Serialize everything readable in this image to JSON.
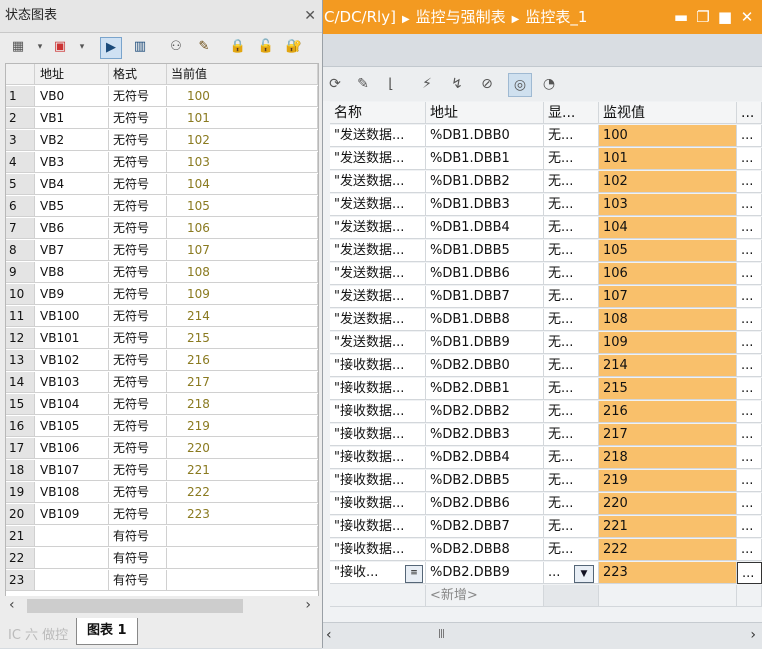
{
  "tia": {
    "title_crumbs": [
      "C/DC/Rly]",
      "监控与强制表",
      "监控表_1"
    ],
    "window_buttons": [
      "▬",
      "❐",
      "■",
      "✕"
    ],
    "columns": [
      "名称",
      "地址",
      "显...",
      "监视值",
      "..."
    ],
    "rows": [
      {
        "name": "\"发送数据...",
        "addr": "%DB1.DBB0",
        "disp": "无...",
        "mon": "100"
      },
      {
        "name": "\"发送数据...",
        "addr": "%DB1.DBB1",
        "disp": "无...",
        "mon": "101"
      },
      {
        "name": "\"发送数据...",
        "addr": "%DB1.DBB2",
        "disp": "无...",
        "mon": "102"
      },
      {
        "name": "\"发送数据...",
        "addr": "%DB1.DBB3",
        "disp": "无...",
        "mon": "103"
      },
      {
        "name": "\"发送数据...",
        "addr": "%DB1.DBB4",
        "disp": "无...",
        "mon": "104"
      },
      {
        "name": "\"发送数据...",
        "addr": "%DB1.DBB5",
        "disp": "无...",
        "mon": "105"
      },
      {
        "name": "\"发送数据...",
        "addr": "%DB1.DBB6",
        "disp": "无...",
        "mon": "106"
      },
      {
        "name": "\"发送数据...",
        "addr": "%DB1.DBB7",
        "disp": "无...",
        "mon": "107"
      },
      {
        "name": "\"发送数据...",
        "addr": "%DB1.DBB8",
        "disp": "无...",
        "mon": "108"
      },
      {
        "name": "\"发送数据...",
        "addr": "%DB1.DBB9",
        "disp": "无...",
        "mon": "109"
      },
      {
        "name": "\"接收数据...",
        "addr": "%DB2.DBB0",
        "disp": "无...",
        "mon": "214"
      },
      {
        "name": "\"接收数据...",
        "addr": "%DB2.DBB1",
        "disp": "无...",
        "mon": "215"
      },
      {
        "name": "\"接收数据...",
        "addr": "%DB2.DBB2",
        "disp": "无...",
        "mon": "216"
      },
      {
        "name": "\"接收数据...",
        "addr": "%DB2.DBB3",
        "disp": "无...",
        "mon": "217"
      },
      {
        "name": "\"接收数据...",
        "addr": "%DB2.DBB4",
        "disp": "无...",
        "mon": "218"
      },
      {
        "name": "\"接收数据...",
        "addr": "%DB2.DBB5",
        "disp": "无...",
        "mon": "219"
      },
      {
        "name": "\"接收数据...",
        "addr": "%DB2.DBB6",
        "disp": "无...",
        "mon": "220"
      },
      {
        "name": "\"接收数据...",
        "addr": "%DB2.DBB7",
        "disp": "无...",
        "mon": "221"
      },
      {
        "name": "\"接收数据...",
        "addr": "%DB2.DBB8",
        "disp": "无...",
        "mon": "222"
      },
      {
        "name": "\"接收...",
        "addr": "%DB2.DBB9",
        "disp": "...",
        "mon": "223"
      }
    ],
    "new_row_label": "<新增>",
    "more_cell": "...",
    "scrollbar_thumb_text": "|||"
  },
  "status_chart": {
    "title": "状态图表",
    "close_icon": "✕",
    "columns": [
      "",
      "地址",
      "格式",
      "当前值"
    ],
    "rows": [
      {
        "no": "1",
        "addr": "VB0",
        "fmt": "无符号",
        "val": "100"
      },
      {
        "no": "2",
        "addr": "VB1",
        "fmt": "无符号",
        "val": "101"
      },
      {
        "no": "3",
        "addr": "VB2",
        "fmt": "无符号",
        "val": "102"
      },
      {
        "no": "4",
        "addr": "VB3",
        "fmt": "无符号",
        "val": "103"
      },
      {
        "no": "5",
        "addr": "VB4",
        "fmt": "无符号",
        "val": "104"
      },
      {
        "no": "6",
        "addr": "VB5",
        "fmt": "无符号",
        "val": "105"
      },
      {
        "no": "7",
        "addr": "VB6",
        "fmt": "无符号",
        "val": "106"
      },
      {
        "no": "8",
        "addr": "VB7",
        "fmt": "无符号",
        "val": "107"
      },
      {
        "no": "9",
        "addr": "VB8",
        "fmt": "无符号",
        "val": "108"
      },
      {
        "no": "10",
        "addr": "VB9",
        "fmt": "无符号",
        "val": "109"
      },
      {
        "no": "11",
        "addr": "VB100",
        "fmt": "无符号",
        "val": "214"
      },
      {
        "no": "12",
        "addr": "VB101",
        "fmt": "无符号",
        "val": "215"
      },
      {
        "no": "13",
        "addr": "VB102",
        "fmt": "无符号",
        "val": "216"
      },
      {
        "no": "14",
        "addr": "VB103",
        "fmt": "无符号",
        "val": "217"
      },
      {
        "no": "15",
        "addr": "VB104",
        "fmt": "无符号",
        "val": "218"
      },
      {
        "no": "16",
        "addr": "VB105",
        "fmt": "无符号",
        "val": "219"
      },
      {
        "no": "17",
        "addr": "VB106",
        "fmt": "无符号",
        "val": "220"
      },
      {
        "no": "18",
        "addr": "VB107",
        "fmt": "无符号",
        "val": "221"
      },
      {
        "no": "19",
        "addr": "VB108",
        "fmt": "无符号",
        "val": "222"
      },
      {
        "no": "20",
        "addr": "VB109",
        "fmt": "无符号",
        "val": "223"
      },
      {
        "no": "21",
        "addr": "",
        "fmt": "有符号",
        "val": ""
      },
      {
        "no": "22",
        "addr": "",
        "fmt": "有符号",
        "val": ""
      },
      {
        "no": "23",
        "addr": "",
        "fmt": "有符号",
        "val": ""
      }
    ],
    "tab_label": "图表 1",
    "watermark": "IC 六 做控"
  },
  "colors": {
    "title_bar": "#f39a21",
    "monitor_highlight": "#f9c06b",
    "value_text": "#8a7a20"
  },
  "icons": {
    "tia_toolbar": [
      "refresh-icon",
      "list-edit-icon",
      "chart-icon",
      "force-icon",
      "force-all-icon",
      "force-stop-icon",
      "monitor-all-icon",
      "monitor-once-icon"
    ],
    "sc_toolbar": [
      "insert-row-icon",
      "delete-row-icon",
      "start-monitor-icon",
      "pause-monitor-icon",
      "single-read-icon",
      "write-pencil-icon",
      "lock-icon",
      "unlock-icon",
      "unlock-all-icon"
    ]
  }
}
